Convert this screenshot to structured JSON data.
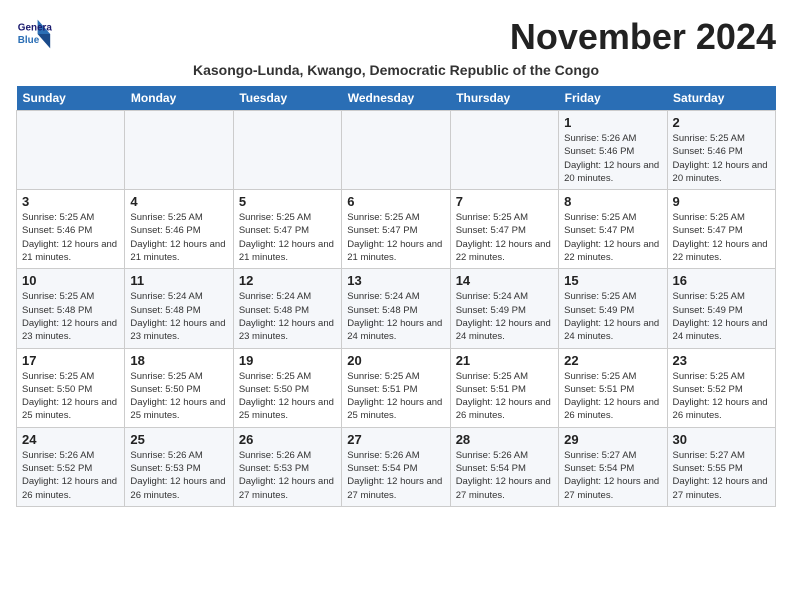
{
  "logo": {
    "line1": "General",
    "line2": "Blue"
  },
  "title": "November 2024",
  "subtitle": "Kasongo-Lunda, Kwango, Democratic Republic of the Congo",
  "weekdays": [
    "Sunday",
    "Monday",
    "Tuesday",
    "Wednesday",
    "Thursday",
    "Friday",
    "Saturday"
  ],
  "weeks": [
    [
      {
        "day": "",
        "info": ""
      },
      {
        "day": "",
        "info": ""
      },
      {
        "day": "",
        "info": ""
      },
      {
        "day": "",
        "info": ""
      },
      {
        "day": "",
        "info": ""
      },
      {
        "day": "1",
        "info": "Sunrise: 5:26 AM\nSunset: 5:46 PM\nDaylight: 12 hours and 20 minutes."
      },
      {
        "day": "2",
        "info": "Sunrise: 5:25 AM\nSunset: 5:46 PM\nDaylight: 12 hours and 20 minutes."
      }
    ],
    [
      {
        "day": "3",
        "info": "Sunrise: 5:25 AM\nSunset: 5:46 PM\nDaylight: 12 hours and 21 minutes."
      },
      {
        "day": "4",
        "info": "Sunrise: 5:25 AM\nSunset: 5:46 PM\nDaylight: 12 hours and 21 minutes."
      },
      {
        "day": "5",
        "info": "Sunrise: 5:25 AM\nSunset: 5:47 PM\nDaylight: 12 hours and 21 minutes."
      },
      {
        "day": "6",
        "info": "Sunrise: 5:25 AM\nSunset: 5:47 PM\nDaylight: 12 hours and 21 minutes."
      },
      {
        "day": "7",
        "info": "Sunrise: 5:25 AM\nSunset: 5:47 PM\nDaylight: 12 hours and 22 minutes."
      },
      {
        "day": "8",
        "info": "Sunrise: 5:25 AM\nSunset: 5:47 PM\nDaylight: 12 hours and 22 minutes."
      },
      {
        "day": "9",
        "info": "Sunrise: 5:25 AM\nSunset: 5:47 PM\nDaylight: 12 hours and 22 minutes."
      }
    ],
    [
      {
        "day": "10",
        "info": "Sunrise: 5:25 AM\nSunset: 5:48 PM\nDaylight: 12 hours and 23 minutes."
      },
      {
        "day": "11",
        "info": "Sunrise: 5:24 AM\nSunset: 5:48 PM\nDaylight: 12 hours and 23 minutes."
      },
      {
        "day": "12",
        "info": "Sunrise: 5:24 AM\nSunset: 5:48 PM\nDaylight: 12 hours and 23 minutes."
      },
      {
        "day": "13",
        "info": "Sunrise: 5:24 AM\nSunset: 5:48 PM\nDaylight: 12 hours and 24 minutes."
      },
      {
        "day": "14",
        "info": "Sunrise: 5:24 AM\nSunset: 5:49 PM\nDaylight: 12 hours and 24 minutes."
      },
      {
        "day": "15",
        "info": "Sunrise: 5:25 AM\nSunset: 5:49 PM\nDaylight: 12 hours and 24 minutes."
      },
      {
        "day": "16",
        "info": "Sunrise: 5:25 AM\nSunset: 5:49 PM\nDaylight: 12 hours and 24 minutes."
      }
    ],
    [
      {
        "day": "17",
        "info": "Sunrise: 5:25 AM\nSunset: 5:50 PM\nDaylight: 12 hours and 25 minutes."
      },
      {
        "day": "18",
        "info": "Sunrise: 5:25 AM\nSunset: 5:50 PM\nDaylight: 12 hours and 25 minutes."
      },
      {
        "day": "19",
        "info": "Sunrise: 5:25 AM\nSunset: 5:50 PM\nDaylight: 12 hours and 25 minutes."
      },
      {
        "day": "20",
        "info": "Sunrise: 5:25 AM\nSunset: 5:51 PM\nDaylight: 12 hours and 25 minutes."
      },
      {
        "day": "21",
        "info": "Sunrise: 5:25 AM\nSunset: 5:51 PM\nDaylight: 12 hours and 26 minutes."
      },
      {
        "day": "22",
        "info": "Sunrise: 5:25 AM\nSunset: 5:51 PM\nDaylight: 12 hours and 26 minutes."
      },
      {
        "day": "23",
        "info": "Sunrise: 5:25 AM\nSunset: 5:52 PM\nDaylight: 12 hours and 26 minutes."
      }
    ],
    [
      {
        "day": "24",
        "info": "Sunrise: 5:26 AM\nSunset: 5:52 PM\nDaylight: 12 hours and 26 minutes."
      },
      {
        "day": "25",
        "info": "Sunrise: 5:26 AM\nSunset: 5:53 PM\nDaylight: 12 hours and 26 minutes."
      },
      {
        "day": "26",
        "info": "Sunrise: 5:26 AM\nSunset: 5:53 PM\nDaylight: 12 hours and 27 minutes."
      },
      {
        "day": "27",
        "info": "Sunrise: 5:26 AM\nSunset: 5:54 PM\nDaylight: 12 hours and 27 minutes."
      },
      {
        "day": "28",
        "info": "Sunrise: 5:26 AM\nSunset: 5:54 PM\nDaylight: 12 hours and 27 minutes."
      },
      {
        "day": "29",
        "info": "Sunrise: 5:27 AM\nSunset: 5:54 PM\nDaylight: 12 hours and 27 minutes."
      },
      {
        "day": "30",
        "info": "Sunrise: 5:27 AM\nSunset: 5:55 PM\nDaylight: 12 hours and 27 minutes."
      }
    ]
  ]
}
